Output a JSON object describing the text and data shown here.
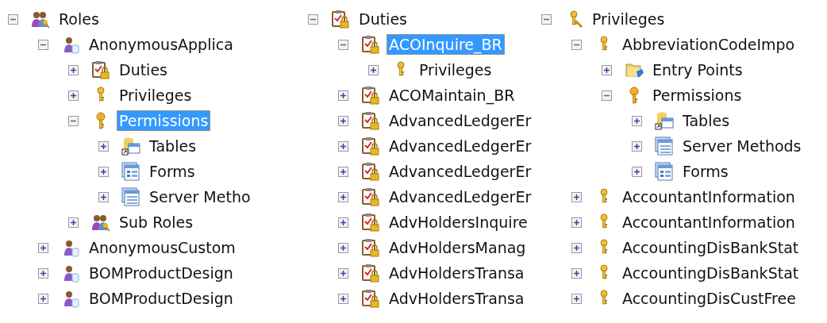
{
  "columns": [
    {
      "label": "Roles",
      "kind": "roles",
      "expanded": true,
      "selected": false,
      "children": [
        {
          "label": "AnonymousApplica",
          "kind": "role",
          "expanded": true,
          "selected": false,
          "children": [
            {
              "label": "Duties",
              "kind": "duties",
              "expanded": false,
              "selected": false
            },
            {
              "label": "Privileges",
              "kind": "privilege",
              "expanded": false,
              "selected": false
            },
            {
              "label": "Permissions",
              "kind": "permissions",
              "expanded": true,
              "selected": true,
              "children": [
                {
                  "label": "Tables",
                  "kind": "tables",
                  "expanded": false,
                  "selected": false
                },
                {
                  "label": "Forms",
                  "kind": "forms",
                  "expanded": false,
                  "selected": false
                },
                {
                  "label": "Server Metho",
                  "kind": "server-methods",
                  "expanded": false,
                  "selected": false
                }
              ]
            },
            {
              "label": "Sub Roles",
              "kind": "roles",
              "expanded": false,
              "selected": false
            }
          ]
        },
        {
          "label": "AnonymousCustom",
          "kind": "role",
          "expanded": false,
          "selected": false
        },
        {
          "label": "BOMProductDesign",
          "kind": "role",
          "expanded": false,
          "selected": false
        },
        {
          "label": "BOMProductDesign",
          "kind": "role",
          "expanded": false,
          "selected": false
        }
      ]
    },
    {
      "label": "Duties",
      "kind": "duties",
      "expanded": true,
      "selected": false,
      "children": [
        {
          "label": "ACOInquire_BR",
          "kind": "duty",
          "expanded": true,
          "selected": true,
          "children": [
            {
              "label": "Privileges",
              "kind": "privilege",
              "expanded": false,
              "selected": false
            }
          ]
        },
        {
          "label": "ACOMaintain_BR",
          "kind": "duty",
          "expanded": false,
          "selected": false
        },
        {
          "label": "AdvancedLedgerEr",
          "kind": "duty",
          "expanded": false,
          "selected": false
        },
        {
          "label": "AdvancedLedgerEr",
          "kind": "duty",
          "expanded": false,
          "selected": false
        },
        {
          "label": "AdvancedLedgerEr",
          "kind": "duty",
          "expanded": false,
          "selected": false
        },
        {
          "label": "AdvancedLedgerEr",
          "kind": "duty",
          "expanded": false,
          "selected": false
        },
        {
          "label": "AdvHoldersInquire",
          "kind": "duty",
          "expanded": false,
          "selected": false
        },
        {
          "label": "AdvHoldersManag",
          "kind": "duty",
          "expanded": false,
          "selected": false
        },
        {
          "label": "AdvHoldersTransa",
          "kind": "duty",
          "expanded": false,
          "selected": false
        },
        {
          "label": "AdvHoldersTransa",
          "kind": "duty",
          "expanded": false,
          "selected": false
        }
      ]
    },
    {
      "label": "Privileges",
      "kind": "privileges",
      "expanded": true,
      "selected": false,
      "children": [
        {
          "label": "AbbreviationCodeImpo",
          "kind": "privilege",
          "expanded": true,
          "selected": false,
          "children": [
            {
              "label": "Entry Points",
              "kind": "entry-points",
              "expanded": false,
              "selected": false
            },
            {
              "label": "Permissions",
              "kind": "permissions",
              "expanded": true,
              "selected": false,
              "children": [
                {
                  "label": "Tables",
                  "kind": "tables",
                  "expanded": false,
                  "selected": false
                },
                {
                  "label": "Server Methods",
                  "kind": "server-methods",
                  "expanded": false,
                  "selected": false
                },
                {
                  "label": "Forms",
                  "kind": "forms",
                  "expanded": false,
                  "selected": false
                }
              ]
            }
          ]
        },
        {
          "label": "AccountantInformation",
          "kind": "privilege",
          "expanded": false,
          "selected": false
        },
        {
          "label": "AccountantInformation",
          "kind": "privilege",
          "expanded": false,
          "selected": false
        },
        {
          "label": "AccountingDisBankStat",
          "kind": "privilege",
          "expanded": false,
          "selected": false
        },
        {
          "label": "AccountingDisBankStat",
          "kind": "privilege",
          "expanded": false,
          "selected": false
        },
        {
          "label": "AccountingDisCustFree",
          "kind": "privilege",
          "expanded": false,
          "selected": false
        }
      ]
    }
  ]
}
